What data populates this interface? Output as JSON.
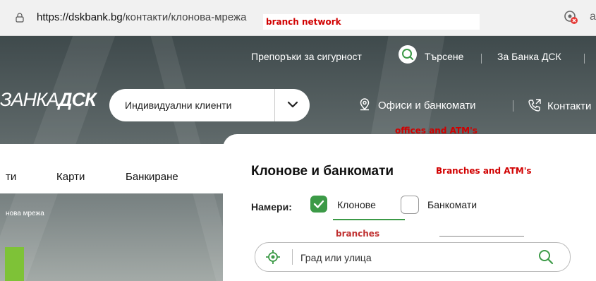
{
  "browser": {
    "url_domain": "https://dskbank.bg",
    "url_path": "/контакти/клонова-мрежа"
  },
  "annotations": {
    "top": "branch network",
    "offices": "offices and ATM's",
    "panel_title": "Branches and ATM's",
    "branches": "branches"
  },
  "topnav": {
    "security": "Препоръки за сигурност",
    "search": "Търсене",
    "about": "За Банка ДСК"
  },
  "brand": {
    "logo_left": "ЗАНКА",
    "logo_right": "ДСК"
  },
  "segment_dropdown": {
    "label": "Индивидуални клиенти"
  },
  "header_links": {
    "offices": "Офиси и банкомати",
    "contacts": "Контакти"
  },
  "mainnav": {
    "item1": "ти",
    "item2": "Карти",
    "item3": "Банкиране"
  },
  "breadcrumb": "нова мрежа",
  "panel": {
    "title": "Клонове и банкомати",
    "find_label": "Намери:",
    "filter_branches": "Клонове",
    "filter_atms": "Банкомати",
    "filter_branches_checked": true,
    "filter_atms_checked": false,
    "search_placeholder": "Град или улица"
  },
  "colors": {
    "green": "#3c9a47",
    "annotation_red": "#d10000"
  }
}
